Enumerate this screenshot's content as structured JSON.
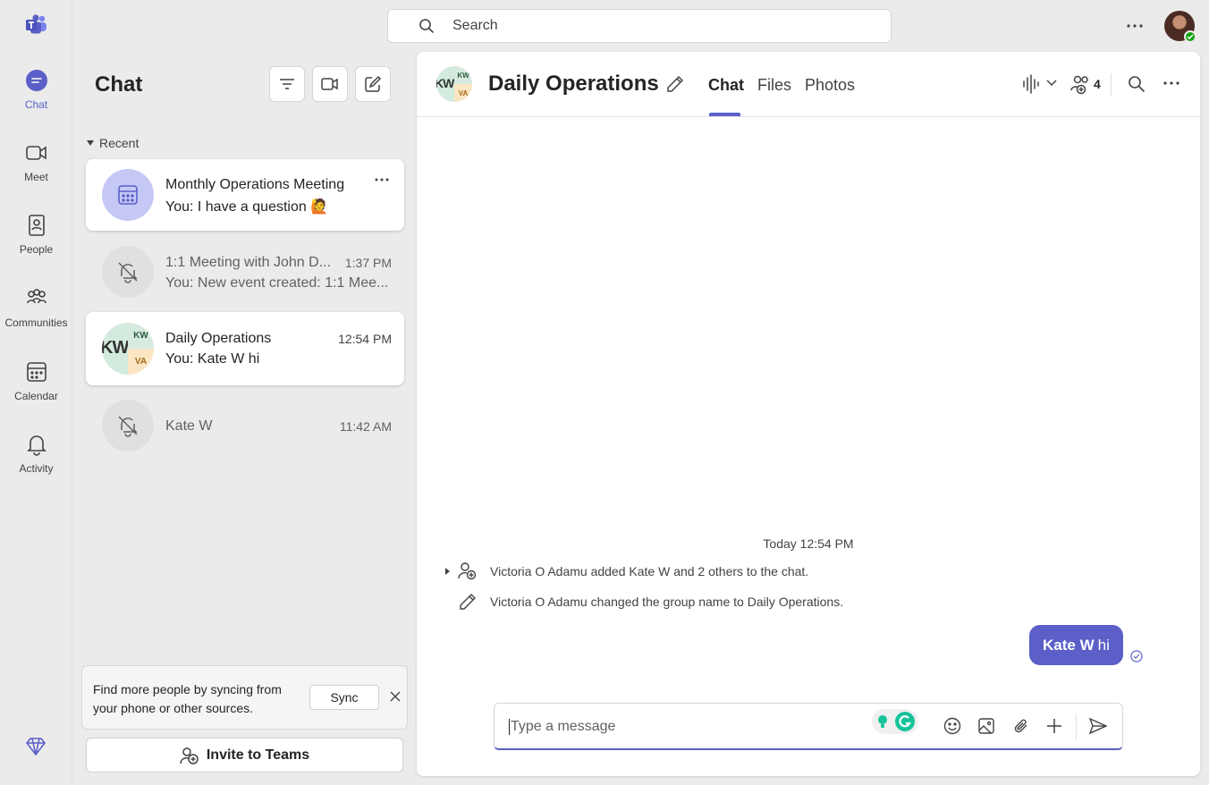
{
  "rail": {
    "items": [
      {
        "label": "Chat",
        "icon": "chat-icon",
        "active": true
      },
      {
        "label": "Meet",
        "icon": "video-icon"
      },
      {
        "label": "People",
        "icon": "people-icon"
      },
      {
        "label": "Communities",
        "icon": "communities-icon"
      },
      {
        "label": "Calendar",
        "icon": "calendar-icon"
      },
      {
        "label": "Activity",
        "icon": "bell-icon"
      }
    ]
  },
  "search": {
    "placeholder": "Search"
  },
  "chat_pane": {
    "title": "Chat",
    "section_label": "Recent",
    "items": [
      {
        "name": "Monthly Operations Meeting",
        "preview": "You: I have a question 🙋",
        "time": "",
        "avatar": "calendar-icon"
      },
      {
        "name": "1:1 Meeting with John D...",
        "preview": "You: New event created: 1:1 Mee...",
        "time": "1:37 PM",
        "avatar": "muted-bell-icon"
      },
      {
        "name": "Daily Operations",
        "preview": "You: Kate W hi",
        "time": "12:54 PM",
        "avatar": "group-avatar"
      },
      {
        "name": "Kate W",
        "preview": "",
        "time": "11:42 AM",
        "avatar": "muted-bell-icon"
      }
    ],
    "group_avatar": {
      "main": "KW",
      "tr": "KW",
      "br": "VA"
    },
    "sync_text": "Find more people by syncing from your phone or other sources.",
    "sync_button": "Sync",
    "invite_button": "Invite to Teams"
  },
  "conversation": {
    "title": "Daily Operations",
    "tabs": [
      "Chat",
      "Files",
      "Photos"
    ],
    "participant_count": "4",
    "date_separator": "Today 12:54 PM",
    "events": [
      "Victoria O Adamu added Kate W and 2 others to the chat.",
      "Victoria O Adamu changed the group name to Daily Operations."
    ],
    "message": {
      "mention": "Kate W",
      "text": "hi"
    },
    "compose_placeholder": "Type a message"
  },
  "colors": {
    "accent": "#5b5fc7",
    "background": "#ebebeb",
    "surface": "#ffffff"
  }
}
